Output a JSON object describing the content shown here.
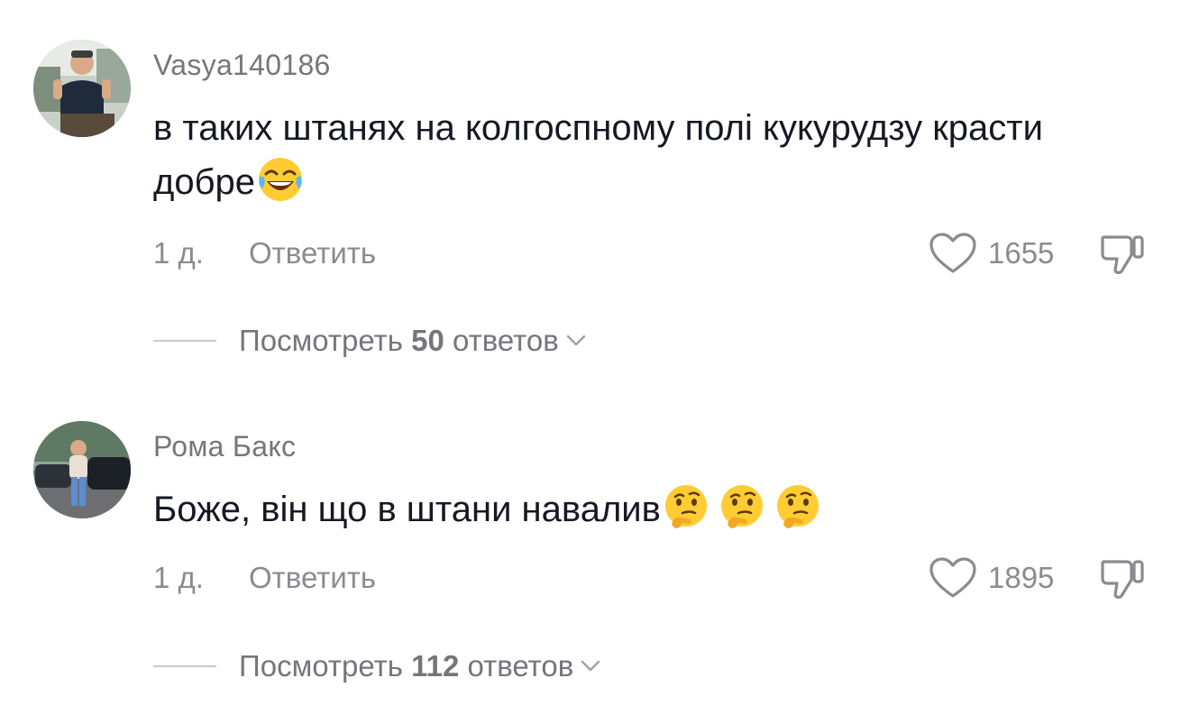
{
  "comments": [
    {
      "username": "Vasya140186",
      "text": "в таких штанях на колгоспному полі кукурудзу красти добре",
      "emoji": [
        "face-with-tears-of-joy"
      ],
      "age": "1 д.",
      "reply_label": "Ответить",
      "likes": "1655",
      "replies_prefix": "Посмотреть",
      "replies_count": "50",
      "replies_suffix": "ответов"
    },
    {
      "username": "Рома Бакс",
      "text": "Боже, він що в штани навалив",
      "emoji": [
        "thinking-face",
        "thinking-face",
        "thinking-face"
      ],
      "age": "1 д.",
      "reply_label": "Ответить",
      "likes": "1895",
      "replies_prefix": "Посмотреть",
      "replies_count": "112",
      "replies_suffix": "ответов"
    }
  ],
  "colors": {
    "primary_text": "#161823",
    "secondary_text": "#8a8b91",
    "username_text": "#75767c",
    "divider": "#c8c9cc",
    "background": "#ffffff"
  }
}
